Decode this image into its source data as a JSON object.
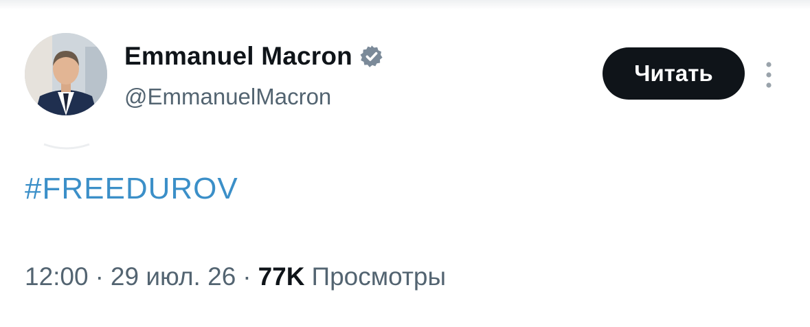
{
  "post": {
    "author": {
      "display_name": "Emmanuel Macron",
      "handle": "@EmmanuelMacron",
      "verified_icon": "verified-badge-icon",
      "verified_color": "#7b8a99"
    },
    "follow_label": "Читать",
    "more_icon": "more-vertical-icon",
    "text": "#FREEDUROV",
    "meta": {
      "time": "12:00",
      "date": "29 июл. 26",
      "separator": "·",
      "views_count": "77K",
      "views_label": "Просмотры"
    }
  },
  "colors": {
    "text_primary": "#0f1419",
    "text_secondary": "#536471",
    "hashtag": "#3b8fc8",
    "button_bg": "#0f1419",
    "button_text": "#ffffff"
  }
}
